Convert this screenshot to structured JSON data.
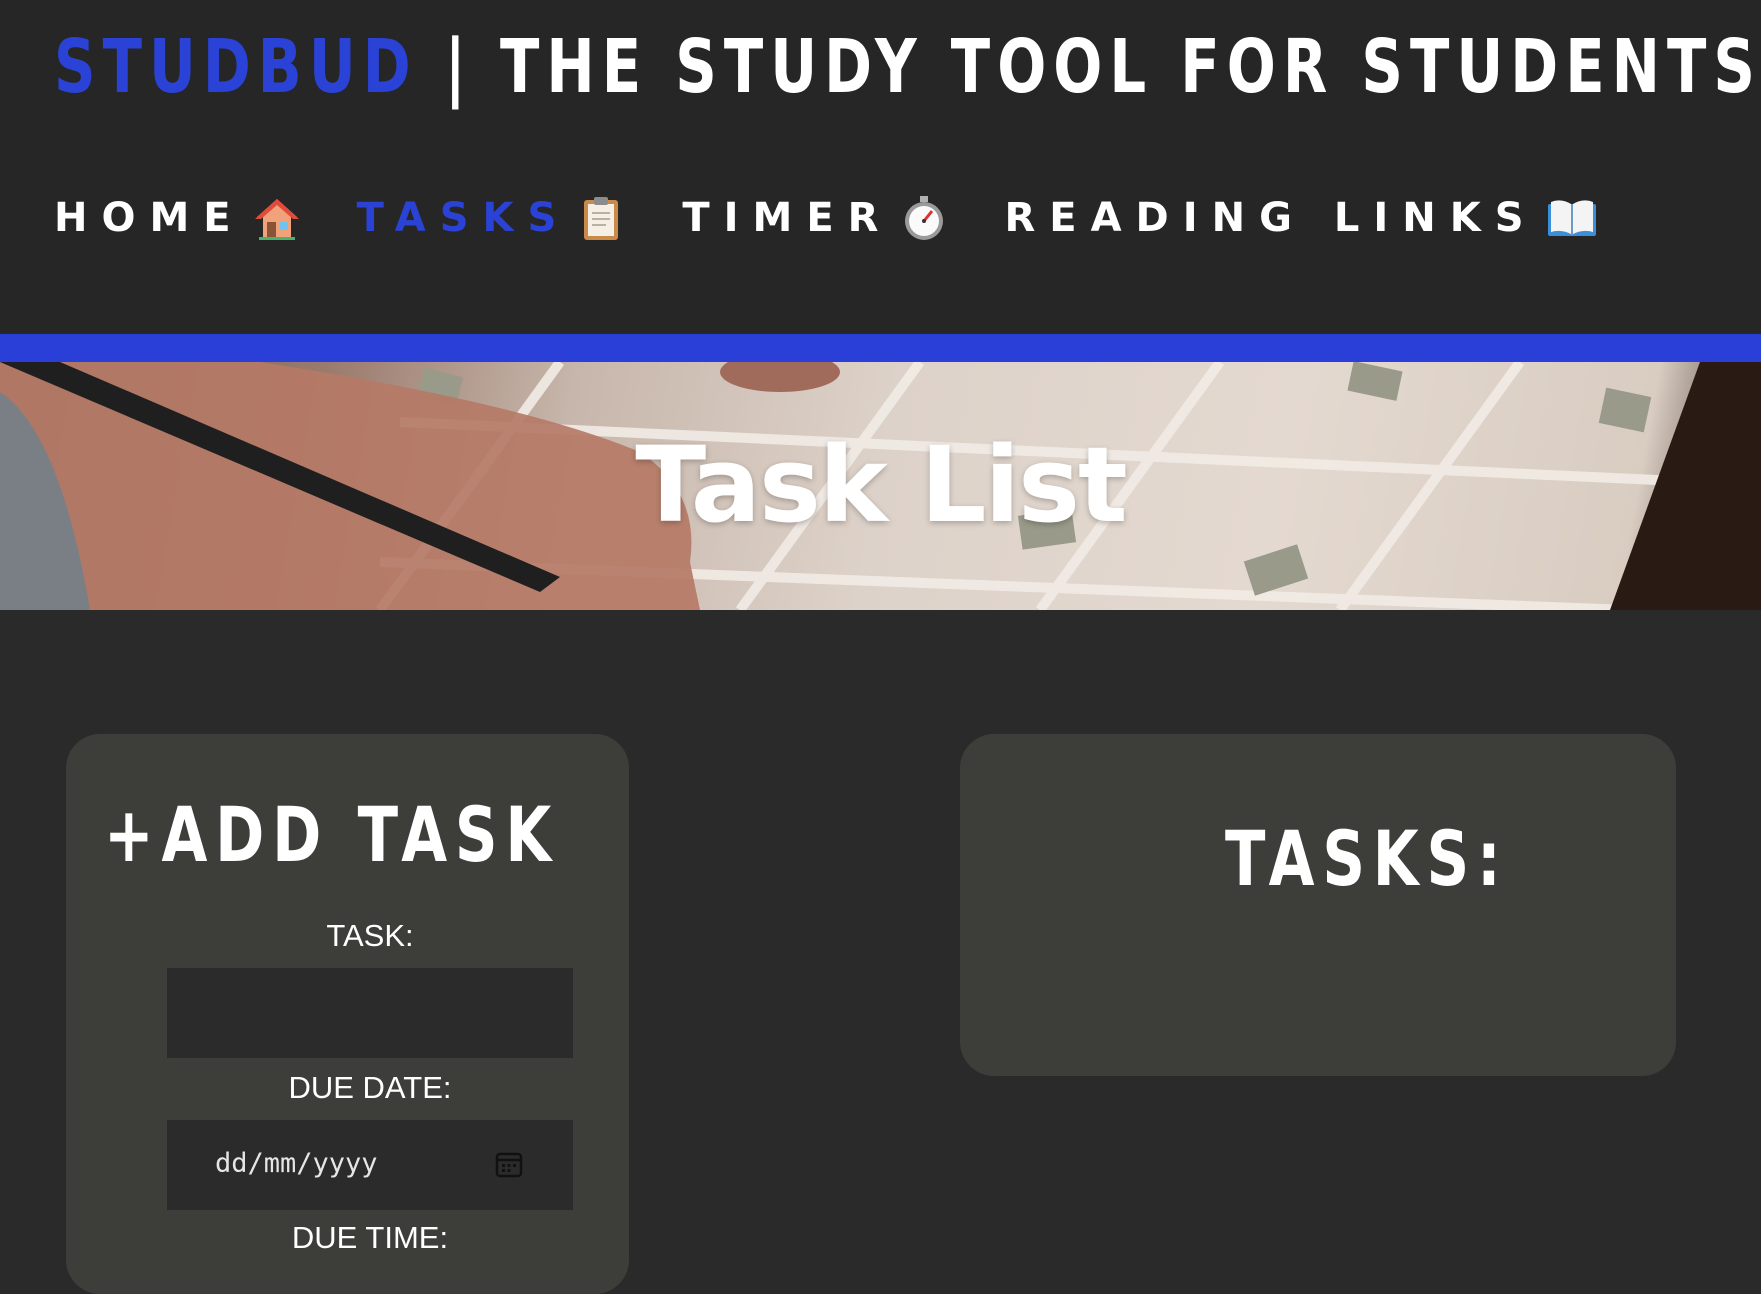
{
  "header": {
    "brand_accent": "STUDBUD",
    "brand_rest": " | THE STUDY TOOL FOR STUDENTS",
    "accent_color": "#2a43d6"
  },
  "nav": [
    {
      "label": "HOME",
      "icon": "house-icon"
    },
    {
      "label": "TASKS",
      "icon": "clipboard-icon",
      "active": true
    },
    {
      "label": "TIMER",
      "icon": "stopwatch-icon"
    },
    {
      "label": "READING LINKS",
      "icon": "open-book-icon"
    }
  ],
  "hero": {
    "title": "Task List"
  },
  "add_task": {
    "title": "+ADD TASK",
    "task_label": "TASK:",
    "task_value": "",
    "due_date_label": "DUE DATE:",
    "due_date_placeholder": "dd/mm/yyyy",
    "due_time_label": "DUE TIME:"
  },
  "tasks_panel": {
    "title": "TASKS:"
  }
}
